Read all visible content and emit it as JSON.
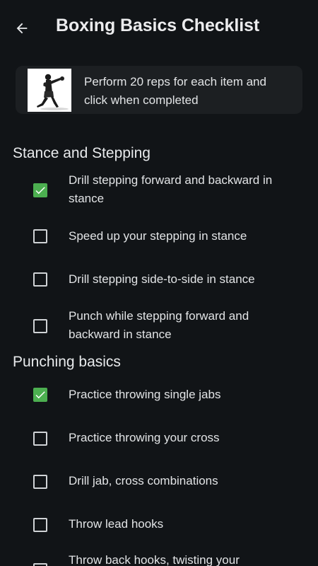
{
  "header": {
    "title": "Boxing Basics Checklist",
    "back_icon": "arrow-back-icon"
  },
  "info": {
    "text": "Perform 20 reps for each item and click when completed",
    "image_icon": "boxer-figure-image"
  },
  "colors": {
    "background": "#111417",
    "card": "#1c1f22",
    "checked": "#4caf50"
  },
  "sections": [
    {
      "title": "Stance and Stepping",
      "items": [
        {
          "label": "Drill stepping forward and backward in stance",
          "checked": true
        },
        {
          "label": "Speed up your stepping in stance",
          "checked": false
        },
        {
          "label": "Drill stepping side-to-side in stance",
          "checked": false
        },
        {
          "label": "Punch while stepping forward and backward in stance",
          "checked": false
        }
      ]
    },
    {
      "title": "Punching basics",
      "items": [
        {
          "label": "Practice throwing single jabs",
          "checked": true
        },
        {
          "label": "Practice throwing your cross",
          "checked": false
        },
        {
          "label": "Drill jab, cross combinations",
          "checked": false
        },
        {
          "label": "Throw lead hooks",
          "checked": false
        },
        {
          "label": "Throw back hooks, twisting your",
          "checked": false
        }
      ]
    }
  ]
}
